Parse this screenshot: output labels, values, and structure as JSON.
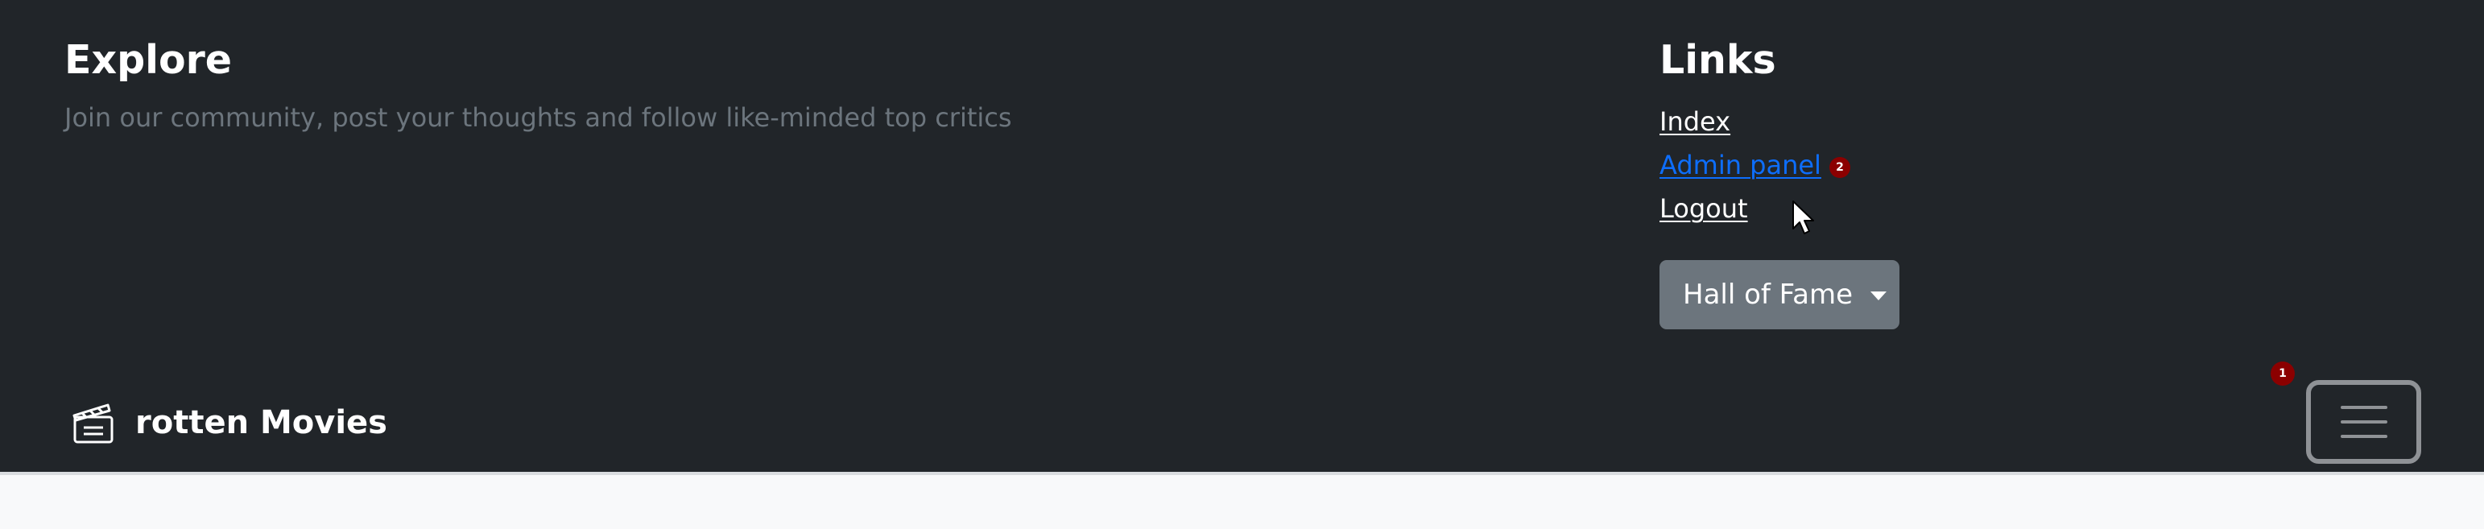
{
  "explore": {
    "title": "Explore",
    "tagline": "Join our community, post your thoughts and follow like-minded top critics"
  },
  "links": {
    "title": "Links",
    "items": [
      {
        "label": "Index",
        "active": false
      },
      {
        "label": "Admin panel",
        "active": true,
        "badge": "2"
      },
      {
        "label": "Logout",
        "active": false
      }
    ],
    "dropdown_label": "Hall of Fame"
  },
  "navbar": {
    "brand_icon": "film-clapperboard-icon",
    "brand_name": "rotten Movies",
    "notification_count": "1",
    "toggler_icon": "hamburger-menu-icon"
  },
  "colors": {
    "footer_bg": "#212529",
    "page_bg": "#f8f9fa",
    "muted_text": "#6c757d",
    "link_active": "#0d6efd",
    "badge_bg": "#8b0000",
    "button_bg": "#6c757d"
  }
}
